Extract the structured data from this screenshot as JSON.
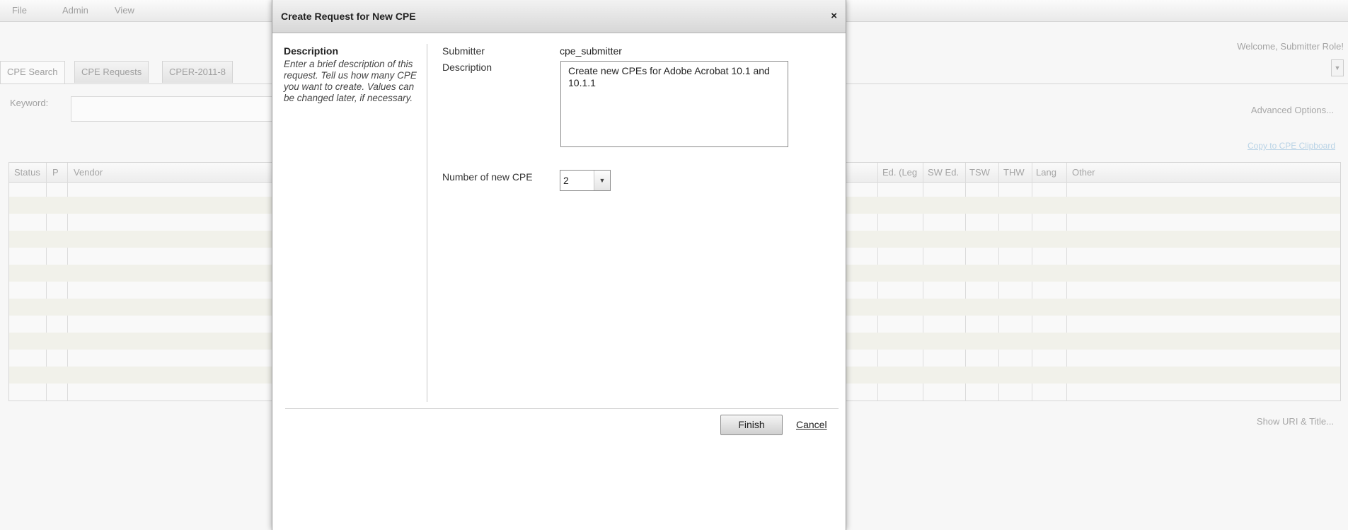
{
  "menu": {
    "items": [
      "File",
      "Admin",
      "View"
    ]
  },
  "welcome_text": "Welcome, Submitter Role!",
  "tabs": [
    {
      "label": "CPE Search"
    },
    {
      "label": "CPE Requests"
    },
    {
      "label": "CPER-2011-8"
    }
  ],
  "search": {
    "keyword_label": "Keyword:",
    "keyword_value": ""
  },
  "links": {
    "advanced_options": "Advanced Options...",
    "copy_clipboard": "Copy to CPE Clipboard",
    "show_uri": "Show URI & Title..."
  },
  "grid": {
    "columns": [
      "Status",
      "P",
      "Vendor",
      "Ed. (Leg",
      "SW Ed.",
      "TSW",
      "THW",
      "Lang",
      "Other"
    ]
  },
  "dialog": {
    "title": "Create Request for New CPE",
    "close_glyph": "×",
    "left_heading": "Description",
    "left_help": "Enter a brief description of this request.  Tell us how many CPE you want to create.  Values can be changed later, if necessary.",
    "submitter_label": "Submitter",
    "submitter_value": "cpe_submitter",
    "description_label": "Description",
    "description_value": "Create new CPEs for Adobe Acrobat 10.1 and 10.1.1",
    "number_label": "Number of new CPE",
    "number_value": "2",
    "finish_label": "Finish",
    "cancel_label": "Cancel"
  }
}
